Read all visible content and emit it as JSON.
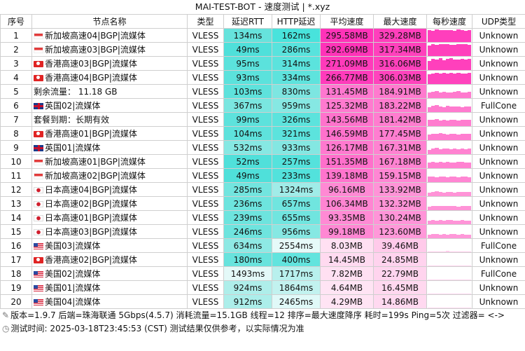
{
  "title": "MAI-TEST-BOT - 速度测试 | *.xyz",
  "headers": [
    "序号",
    "节点名称",
    "类型",
    "延迟RTT",
    "HTTP延迟",
    "平均速度",
    "最大速度",
    "每秒速度",
    "UDP类型"
  ],
  "rows": [
    {
      "idx": "1",
      "flag": "sg",
      "name": "新加坡高速04|BGP|流媒体",
      "type": "VLESS",
      "rtt": "134ms",
      "http": "162ms",
      "avg": "295.58MB",
      "max": "329.28MB",
      "udp": "Unknown",
      "rtt_color": "#66e3dc",
      "http_color": "#48e3dc",
      "avg_color": "#ff33b8",
      "max_color": "#ff3fbc",
      "spark": [
        0.9,
        0.85,
        0.95,
        0.9,
        0.88,
        0.92,
        0.9,
        0.86,
        0.93,
        0.9,
        0.85,
        0.9
      ]
    },
    {
      "idx": "2",
      "flag": "sg",
      "name": "新加坡高速03|BGP|流媒体",
      "type": "VLESS",
      "rtt": "49ms",
      "http": "286ms",
      "avg": "292.69MB",
      "max": "317.34MB",
      "udp": "Unknown",
      "rtt_color": "#4fe0da",
      "http_color": "#58e3dd",
      "avg_color": "#ff33b8",
      "max_color": "#ff40bc",
      "spark": [
        0.8,
        0.9,
        0.85,
        0.92,
        0.88,
        0.9,
        0.86,
        0.84,
        0.9,
        0.88,
        0.92,
        0.85
      ]
    },
    {
      "idx": "3",
      "flag": "hk",
      "name": "香港高速03|BGP|流媒体",
      "type": "VLESS",
      "rtt": "95ms",
      "http": "314ms",
      "avg": "271.09MB",
      "max": "316.06MB",
      "udp": "Unknown",
      "rtt_color": "#5be2dc",
      "http_color": "#5be3dd",
      "avg_color": "#ff3aba",
      "max_color": "#ff40bc",
      "spark": [
        0.7,
        0.85,
        0.8,
        0.9,
        0.75,
        0.82,
        0.88,
        0.8,
        0.78,
        0.86,
        0.8,
        0.83
      ]
    },
    {
      "idx": "4",
      "flag": "hk",
      "name": "香港高速04|BGP|流媒体",
      "type": "VLESS",
      "rtt": "93ms",
      "http": "334ms",
      "avg": "266.77MB",
      "max": "306.03MB",
      "udp": "Unknown",
      "rtt_color": "#5be2dc",
      "http_color": "#5ee3dd",
      "avg_color": "#ff3bbb",
      "max_color": "#ff43bd",
      "spark": [
        0.75,
        0.8,
        0.85,
        0.78,
        0.82,
        0.8,
        0.86,
        0.79,
        0.83,
        0.8,
        0.77,
        0.82
      ]
    },
    {
      "idx": "5",
      "flag": "",
      "name": "剩余流量： 11.18 GB",
      "type": "VLESS",
      "rtt": "103ms",
      "http": "830ms",
      "avg": "131.45MB",
      "max": "184.91MB",
      "udp": "Unknown",
      "rtt_color": "#5ee2dc",
      "http_color": "#7de6e1",
      "avg_color": "#ff77cf",
      "max_color": "#ff7ace",
      "spark": [
        0.4,
        0.45,
        0.5,
        0.42,
        0.48,
        0.44,
        0.4,
        0.46,
        0.5,
        0.43,
        0.41,
        0.45
      ]
    },
    {
      "idx": "6",
      "flag": "uk",
      "name": "英国02|流媒体",
      "type": "VLESS",
      "rtt": "367ms",
      "http": "959ms",
      "avg": "125.32MB",
      "max": "183.22MB",
      "udp": "FullCone",
      "rtt_color": "#7ae6e0",
      "http_color": "#86e8e3",
      "avg_color": "#ff7acf",
      "max_color": "#ff7bcf",
      "spark": [
        0.35,
        0.45,
        0.5,
        0.4,
        0.38,
        0.46,
        0.42,
        0.4,
        0.44,
        0.36,
        0.41,
        0.43
      ]
    },
    {
      "idx": "7",
      "flag": "",
      "name": "套餐到期：长期有效",
      "type": "VLESS",
      "rtt": "99ms",
      "http": "326ms",
      "avg": "143.56MB",
      "max": "181.42MB",
      "udp": "Unknown",
      "rtt_color": "#5de2dc",
      "http_color": "#5ce3dd",
      "avg_color": "#ff72cc",
      "max_color": "#ff7ccf",
      "spark": [
        0.45,
        0.48,
        0.5,
        0.44,
        0.47,
        0.43,
        0.49,
        0.46,
        0.44,
        0.48,
        0.45,
        0.47
      ]
    },
    {
      "idx": "8",
      "flag": "hk",
      "name": "香港高速01|BGP|流媒体",
      "type": "VLESS",
      "rtt": "104ms",
      "http": "321ms",
      "avg": "146.59MB",
      "max": "177.45MB",
      "udp": "Unknown",
      "rtt_color": "#5ee2dc",
      "http_color": "#5ce3dd",
      "avg_color": "#ff71cc",
      "max_color": "#ff7dd0",
      "spark": [
        0.42,
        0.46,
        0.48,
        0.5,
        0.45,
        0.44,
        0.47,
        0.49,
        0.43,
        0.46,
        0.48,
        0.45
      ]
    },
    {
      "idx": "9",
      "flag": "uk",
      "name": "英国01|流媒体",
      "type": "VLESS",
      "rtt": "532ms",
      "http": "933ms",
      "avg": "126.17MB",
      "max": "167.31MB",
      "udp": "Unknown",
      "rtt_color": "#86e8e3",
      "http_color": "#84e7e2",
      "avg_color": "#ff79cf",
      "max_color": "#ff82d1",
      "spark": [
        0.3,
        0.42,
        0.45,
        0.38,
        0.4,
        0.44,
        0.36,
        0.41,
        0.39,
        0.43,
        0.37,
        0.4
      ]
    },
    {
      "idx": "10",
      "flag": "sg",
      "name": "新加坡高速01|BGP|流媒体",
      "type": "VLESS",
      "rtt": "52ms",
      "http": "257ms",
      "avg": "151.35MB",
      "max": "167.18MB",
      "udp": "Unknown",
      "rtt_color": "#50e0da",
      "http_color": "#55e2dc",
      "avg_color": "#ff6fcb",
      "max_color": "#ff82d1",
      "spark": [
        0.44,
        0.46,
        0.42,
        0.45,
        0.43,
        0.47,
        0.44,
        0.42,
        0.46,
        0.45,
        0.43,
        0.44
      ]
    },
    {
      "idx": "11",
      "flag": "sg",
      "name": "新加坡高速02|BGP|流媒体",
      "type": "VLESS",
      "rtt": "49ms",
      "http": "233ms",
      "avg": "139.18MB",
      "max": "159.15MB",
      "udp": "Unknown",
      "rtt_color": "#4fe0da",
      "http_color": "#52e2dc",
      "avg_color": "#ff74cd",
      "max_color": "#ff86d3",
      "spark": [
        0.4,
        0.42,
        0.38,
        0.41,
        0.43,
        0.39,
        0.4,
        0.42,
        0.38,
        0.41,
        0.4,
        0.39
      ]
    },
    {
      "idx": "12",
      "flag": "jp",
      "name": "日本高速04|BGP|流媒体",
      "type": "VLESS",
      "rtt": "285ms",
      "http": "1324ms",
      "avg": "96.16MB",
      "max": "133.92MB",
      "udp": "Unknown",
      "rtt_color": "#72e5df",
      "http_color": "#a0ece8",
      "avg_color": "#ff89d4",
      "max_color": "#ff93d7",
      "spark": [
        0.25,
        0.3,
        0.35,
        0.32,
        0.28,
        0.34,
        0.3,
        0.27,
        0.33,
        0.31,
        0.29,
        0.3
      ]
    },
    {
      "idx": "13",
      "flag": "jp",
      "name": "日本高速02|BGP|流媒体",
      "type": "VLESS",
      "rtt": "236ms",
      "http": "657ms",
      "avg": "106.34MB",
      "max": "132.32MB",
      "udp": "Unknown",
      "rtt_color": "#6de4de",
      "http_color": "#70e5df",
      "avg_color": "#ff84d2",
      "max_color": "#ff93d7",
      "spark": [
        0.28,
        0.32,
        0.3,
        0.34,
        0.29,
        0.31,
        0.33,
        0.3,
        0.28,
        0.32,
        0.31,
        0.3
      ]
    },
    {
      "idx": "14",
      "flag": "jp",
      "name": "日本高速01|BGP|流媒体",
      "type": "VLESS",
      "rtt": "239ms",
      "http": "655ms",
      "avg": "93.35MB",
      "max": "130.24MB",
      "udp": "Unknown",
      "rtt_color": "#6de4de",
      "http_color": "#70e5df",
      "avg_color": "#ff8ad4",
      "max_color": "#ff94d8",
      "spark": [
        0.26,
        0.3,
        0.28,
        0.31,
        0.27,
        0.29,
        0.3,
        0.28,
        0.26,
        0.29,
        0.28,
        0.27
      ]
    },
    {
      "idx": "15",
      "flag": "jp",
      "name": "日本高速03|BGP|流媒体",
      "type": "VLESS",
      "rtt": "246ms",
      "http": "956ms",
      "avg": "99.18MB",
      "max": "123.60MB",
      "udp": "Unknown",
      "rtt_color": "#6ee4de",
      "http_color": "#86e8e3",
      "avg_color": "#ff87d3",
      "max_color": "#ff98d9",
      "spark": [
        0.27,
        0.29,
        0.31,
        0.28,
        0.3,
        0.27,
        0.29,
        0.3,
        0.28,
        0.29,
        0.27,
        0.28
      ]
    },
    {
      "idx": "16",
      "flag": "us",
      "name": "美国03|流媒体",
      "type": "VLESS",
      "rtt": "634ms",
      "http": "2554ms",
      "avg": "8.03MB",
      "max": "39.46MB",
      "udp": "FullCone",
      "rtt_color": "#8ee9e4",
      "http_color": "#e6faf9",
      "avg_color": "#ffe0f2",
      "max_color": "#ffcaea",
      "spark": [
        0.02,
        0.03,
        0.05,
        0.04,
        0.06,
        0.08,
        0.06,
        0.05,
        0.07,
        0.06,
        0.05,
        0.06
      ]
    },
    {
      "idx": "17",
      "flag": "hk",
      "name": "香港高速02|BGP|流媒体",
      "type": "VLESS",
      "rtt": "180ms",
      "http": "400ms",
      "avg": "14.45MB",
      "max": "24.85MB",
      "udp": "Unknown",
      "rtt_color": "#68e3dd",
      "http_color": "#62e4de",
      "avg_color": "#ffdaf0",
      "max_color": "#ffd3ee",
      "spark": [
        0.04,
        0.06,
        0.05,
        0.07,
        0.05,
        0.06,
        0.04,
        0.06,
        0.05,
        0.06,
        0.05,
        0.04
      ]
    },
    {
      "idx": "18",
      "flag": "us",
      "name": "美国02|流媒体",
      "type": "VLESS",
      "rtt": "1493ms",
      "http": "1717ms",
      "avg": "7.82MB",
      "max": "22.79MB",
      "udp": "FullCone",
      "rtt_color": "#e4f9f8",
      "http_color": "#b8f0ed",
      "avg_color": "#ffe0f2",
      "max_color": "#ffd4ee",
      "spark": [
        0.01,
        0.02,
        0.04,
        0.03,
        0.05,
        0.06,
        0.04,
        0.03,
        0.05,
        0.04,
        0.03,
        0.04
      ]
    },
    {
      "idx": "19",
      "flag": "us",
      "name": "美国01|流媒体",
      "type": "VLESS",
      "rtt": "924ms",
      "http": "1864ms",
      "avg": "4.64MB",
      "max": "16.45MB",
      "udp": "Unknown",
      "rtt_color": "#aeeeea",
      "http_color": "#c2f2ef",
      "avg_color": "#ffe4f4",
      "max_color": "#ffd8ef",
      "spark": [
        0.01,
        0.02,
        0.03,
        0.02,
        0.04,
        0.03,
        0.02,
        0.03,
        0.02,
        0.03,
        0.02,
        0.03
      ]
    },
    {
      "idx": "20",
      "flag": "us",
      "name": "美国04|流媒体",
      "type": "VLESS",
      "rtt": "912ms",
      "http": "2465ms",
      "avg": "4.29MB",
      "max": "14.86MB",
      "udp": "Unknown",
      "rtt_color": "#aceeea",
      "http_color": "#e0f9f8",
      "avg_color": "#ffe4f4",
      "max_color": "#ffd9f0",
      "spark": [
        0.01,
        0.02,
        0.02,
        0.03,
        0.02,
        0.03,
        0.02,
        0.02,
        0.03,
        0.02,
        0.02,
        0.03
      ]
    }
  ],
  "footer": {
    "line1": "版本=1.9.7  后端=珠海联通 5Gbps(4.5.7)  消耗流量=15.1GB  线程=12  排序=最大速度降序  耗时=199s  Ping=5次  过滤器= <->",
    "line2": "测试时间: 2025-03-18T23:45:53 (CST)  测试结果仅供参考，以实际情况为准",
    "icon1": "✎",
    "icon2": "◷"
  }
}
